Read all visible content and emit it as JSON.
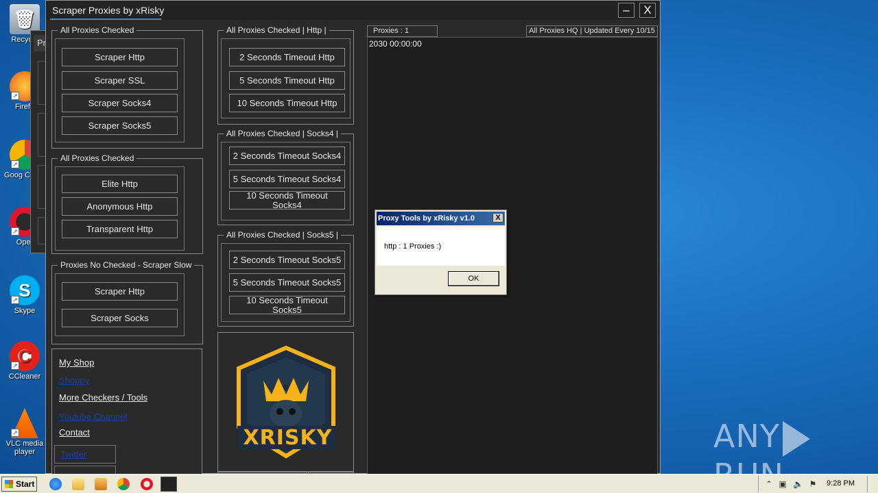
{
  "desktop": {
    "icons": [
      {
        "label": "Recycle"
      },
      {
        "label": "Firefo"
      },
      {
        "label": "Goog Chron"
      },
      {
        "label": "Oper"
      },
      {
        "label": "Skype"
      },
      {
        "label": "CCleaner"
      },
      {
        "label": "VLC media player"
      }
    ],
    "behind_window_tab": "Pr"
  },
  "app": {
    "title": "Scraper Proxies by xRisky",
    "minimize_label": "–",
    "close_label": "X",
    "group_all_checked_1": {
      "legend": "All Proxies Checked",
      "buttons": [
        "Scraper Http",
        "Scraper SSL",
        "Scraper Socks4",
        "Scraper Socks5"
      ]
    },
    "group_all_checked_2": {
      "legend": "All Proxies Checked",
      "buttons": [
        "Elite Http",
        "Anonymous Http",
        "Transparent Http"
      ]
    },
    "group_no_checked": {
      "legend": "Proxies No Checked - Scraper Slow",
      "buttons": [
        "Scraper Http",
        "Scraper Socks"
      ]
    },
    "group_http": {
      "legend": "All Proxies Checked | Http |",
      "buttons": [
        "2 Seconds Timeout Http",
        "5 Seconds Timeout Http",
        "10 Seconds Timeout Http"
      ]
    },
    "group_socks4": {
      "legend": "All Proxies Checked | Socks4 |",
      "buttons": [
        "2 Seconds Timeout Socks4",
        "5 Seconds Timeout Socks4",
        "10 Seconds Timeout Socks4"
      ]
    },
    "group_socks5": {
      "legend": "All Proxies Checked | Socks5 |",
      "buttons": [
        "2 Seconds Timeout Socks5",
        "5 Seconds Timeout Socks5",
        "10 Seconds Timeout Socks5"
      ]
    },
    "links": [
      "My Shop",
      "Shoppy",
      "More Checkers / Tools",
      "Youtube Channel",
      "Contact",
      "Twitter"
    ],
    "logo_text": "XRISKY",
    "status_left": "Proxies : 1",
    "status_right": "All Proxies HQ | Updated Every 10/15",
    "output_line": "2030 00:00:00"
  },
  "dialog": {
    "title": "Proxy Tools by xRisky v1.0",
    "close_label": "X",
    "message": "http :  1 Proxies :)",
    "ok_label": "OK"
  },
  "watermark": {
    "left": "ANY",
    "right": "RUN"
  },
  "taskbar": {
    "start_label": "Start",
    "clock": "9:28 PM"
  },
  "colors": {
    "app_bg": "#2a2a2a",
    "title_accent": "#3a87d8",
    "desktop": "#1a6fc0",
    "dialog_title": "#0a246a"
  }
}
